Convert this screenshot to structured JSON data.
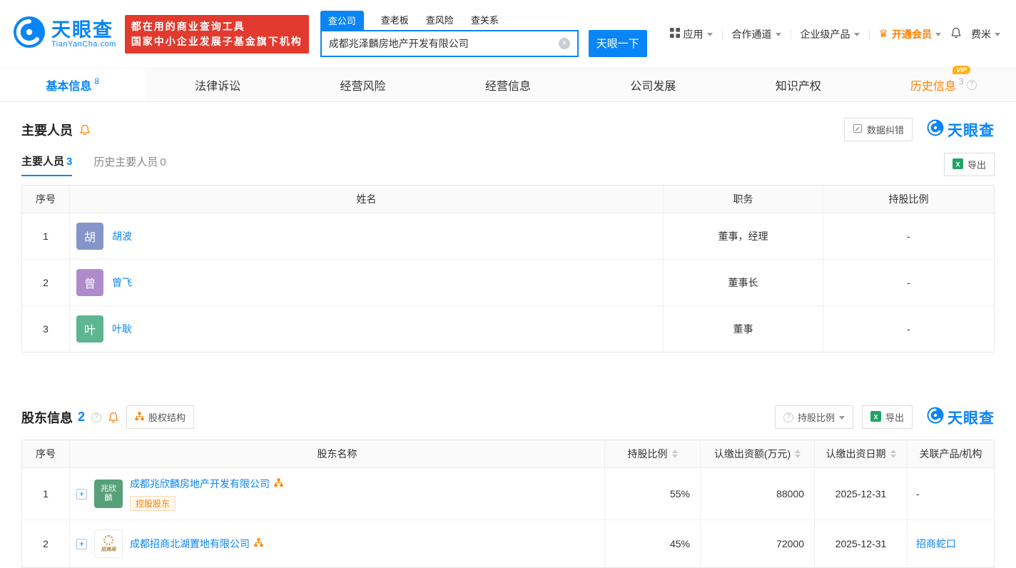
{
  "header": {
    "brand": "天眼查",
    "brand_domain": "TianYanCha.com",
    "banner_line1": "都在用的商业查询工具",
    "banner_line2": "国家中小企业发展子基金旗下机构",
    "search_tabs": {
      "company": "查公司",
      "boss": "查老板",
      "risk": "查风险",
      "relation": "查关系"
    },
    "search_value": "成都兆泽麟房地产开发有限公司",
    "search_button": "天眼一下",
    "nav_app": "应用",
    "nav_coop": "合作通道",
    "nav_enterprise": "企业级产品",
    "nav_vip": "开通会员",
    "nav_user": "费米"
  },
  "colors": {
    "brand_blue": "#0a85f5",
    "banner_red": "#e23a2e",
    "vip_orange": "#ff8000"
  },
  "tabs": {
    "basic": {
      "label": "基本信息",
      "count": "8"
    },
    "legal": {
      "label": "法律诉讼"
    },
    "risk": {
      "label": "经营风险"
    },
    "operation": {
      "label": "经营信息"
    },
    "development": {
      "label": "公司发展"
    },
    "ip": {
      "label": "知识产权"
    },
    "history": {
      "label": "历史信息",
      "count": "3",
      "vip_badge": "VIP"
    }
  },
  "members": {
    "title": "主要人员",
    "correction_button": "数据纠错",
    "watermark": "天眼查",
    "tab_current": "主要人员",
    "tab_current_count": "3",
    "tab_history": "历史主要人员",
    "tab_history_count": "0",
    "export_button": "导出",
    "headers": {
      "no": "序号",
      "name": "姓名",
      "position": "职务",
      "ratio": "持股比例"
    },
    "rows": [
      {
        "no": "1",
        "avatar": "胡",
        "avatar_color": "#8595c9",
        "name": "胡波",
        "position": "董事，经理",
        "ratio": "-"
      },
      {
        "no": "2",
        "avatar": "曾",
        "avatar_color": "#b08bcc",
        "name": "曾飞",
        "position": "董事长",
        "ratio": "-"
      },
      {
        "no": "3",
        "avatar": "叶",
        "avatar_color": "#5eb592",
        "name": "叶耿",
        "position": "董事",
        "ratio": "-"
      }
    ]
  },
  "shareholders": {
    "title": "股东信息",
    "count": "2",
    "structure_button": "股权结构",
    "ratio_filter": "持股比例",
    "export_button": "导出",
    "watermark": "天眼查",
    "headers": {
      "no": "序号",
      "name": "股东名称",
      "ratio": "持股比例",
      "amount": "认缴出资额(万元)",
      "date": "认缴出资日期",
      "related": "关联产品/机构"
    },
    "rows": [
      {
        "no": "1",
        "avatar_line1": "兆欣",
        "avatar_line2": "麟",
        "avatar_color": "#58a07a",
        "name": "成都兆欣麟房地产开发有限公司",
        "tag": "控股股东",
        "ratio": "55%",
        "amount": "88000",
        "date": "2025-12-31",
        "related": "-"
      },
      {
        "no": "2",
        "logo_text": "招商局",
        "name": "成都招商北湖置地有限公司",
        "ratio": "45%",
        "amount": "72000",
        "date": "2025-12-31",
        "related": "招商蛇口"
      }
    ]
  }
}
